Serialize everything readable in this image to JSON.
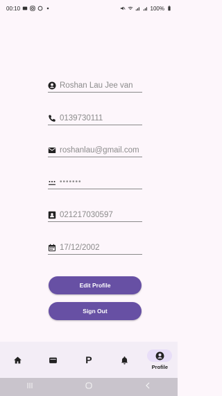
{
  "status_bar": {
    "time": "00:10",
    "battery": "100%"
  },
  "profile": {
    "name": "Roshan Lau Jee van",
    "phone": "0139730111",
    "email": "roshanlau@gmail.com",
    "password_mask": "•••••••",
    "ic_number": "021217030597",
    "birthdate": "17/12/2002"
  },
  "buttons": {
    "edit_profile": "Edit Profile",
    "sign_out": "Sign Out"
  },
  "bottom_nav": {
    "items": [
      {
        "icon": "home-icon"
      },
      {
        "icon": "wallet-icon"
      },
      {
        "label": "P",
        "icon": "parking-icon"
      },
      {
        "icon": "bell-icon"
      },
      {
        "icon": "account-circle-icon",
        "label": "Profile",
        "active": true
      }
    ]
  },
  "colors": {
    "accent": "#6750a4",
    "background": "#fdf6fb",
    "nav_bg": "#f3edf6",
    "active_pill": "#e8def8"
  }
}
